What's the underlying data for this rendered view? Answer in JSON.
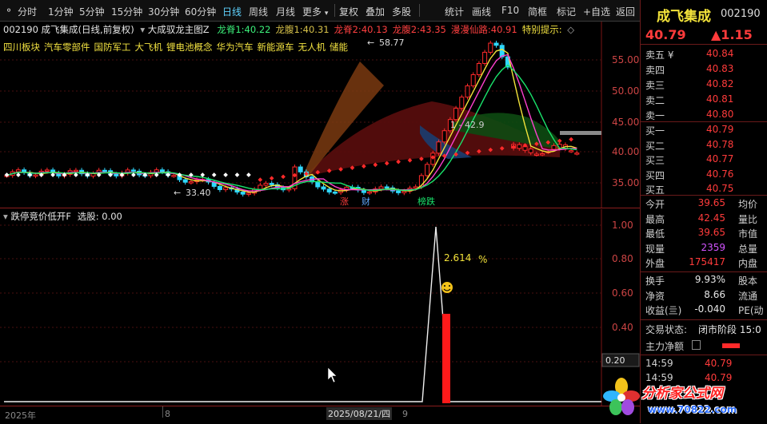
{
  "toolbar": {
    "left_items": [
      "分时",
      "1分钟",
      "5分钟",
      "15分钟",
      "30分钟",
      "60分钟",
      "日线",
      "周线",
      "月线",
      "更多"
    ],
    "active": "日线",
    "right_items": [
      "复权",
      "叠加",
      "多股",
      "统计",
      "画线",
      "F10",
      "简框",
      "标记",
      "+自选",
      "返回"
    ]
  },
  "main_legend": {
    "stock": "002190 成飞集成(日线,前复权)",
    "indicator": "大成驭龙主图Z",
    "items": [
      {
        "label": "龙脊1:",
        "value": "40.22",
        "color": "#3cf07a"
      },
      {
        "label": "龙腹1:",
        "value": "40.31",
        "color": "#d7c24a"
      },
      {
        "label": "龙脊2:",
        "value": "40.13",
        "color": "#ff4040"
      },
      {
        "label": "龙腹2:",
        "value": "43.35",
        "color": "#ff4040"
      },
      {
        "label": "漫漫仙路:",
        "value": "40.91",
        "color": "#ff4040"
      },
      {
        "label": "特别提示:",
        "value": "",
        "color": "#f0e040"
      }
    ],
    "tags": [
      "四川板块",
      "汽车零部件",
      "国防军工",
      "大飞机",
      "锂电池概念",
      "华为汽车",
      "新能源车",
      "无人机",
      "储能"
    ]
  },
  "annotations": {
    "high_label": "58.77",
    "low_label": "33.40",
    "line_label": "1 - 42.9",
    "events": [
      "涨",
      "财",
      "榜跌"
    ]
  },
  "price_axis": [
    "55.00",
    "50.00",
    "45.00",
    "40.00",
    "35.00"
  ],
  "lower_legend": {
    "name": "跌停竞价低开F",
    "select": "选股: 0.00",
    "value_label": "2.614",
    "unit": "%"
  },
  "lower_axis": [
    "1.00",
    "0.80",
    "0.60",
    "0.40",
    "0.20"
  ],
  "lower_badge": "0.20",
  "x_axis": {
    "year": "2025年",
    "tick1": "8",
    "cursor_date": "2025/08/21/四",
    "tick2": "9"
  },
  "quote": {
    "name": "成飞集成",
    "code": "002190",
    "price": "40.79",
    "change": "▲1.15",
    "sell": [
      {
        "label": "卖五 ¥",
        "price": "40.84"
      },
      {
        "label": "卖四",
        "price": "40.83"
      },
      {
        "label": "卖三",
        "price": "40.82"
      },
      {
        "label": "卖二",
        "price": "40.81"
      },
      {
        "label": "卖一",
        "price": "40.80"
      }
    ],
    "buy": [
      {
        "label": "买一",
        "price": "40.79"
      },
      {
        "label": "买二",
        "price": "40.78"
      },
      {
        "label": "买三",
        "price": "40.77"
      },
      {
        "label": "买四",
        "price": "40.76"
      },
      {
        "label": "买五",
        "price": "40.75"
      }
    ],
    "stats": [
      {
        "label": "今开",
        "value": "39.65",
        "label2": "均价",
        "color": "#ff3b3b"
      },
      {
        "label": "最高",
        "value": "42.45",
        "label2": "量比",
        "color": "#ff3b3b"
      },
      {
        "label": "最低",
        "value": "39.65",
        "label2": "市值",
        "color": "#ff3b3b"
      },
      {
        "label": "现量",
        "value": "2359",
        "label2": "总量",
        "color": "#d254ff"
      },
      {
        "label": "外盘",
        "value": "175417",
        "label2": "内盘",
        "color": "#ff3b3b"
      }
    ],
    "stats2": [
      {
        "label": "换手",
        "value": "9.93%",
        "label2": "股本",
        "color": "#e6e6e6"
      },
      {
        "label": "净资",
        "value": "8.66",
        "label2": "流通",
        "color": "#e6e6e6"
      },
      {
        "label": "收益(亖)",
        "value": "-0.040",
        "label2": "PE(动",
        "color": "#e6e6e6"
      }
    ],
    "trade_status_label": "交易状态:",
    "trade_status_value": "闭市阶段 15:0",
    "net_label": "主力净额",
    "ticks": [
      {
        "time": "14:59",
        "price": "40.79"
      },
      {
        "time": "14:59",
        "price": "40.79"
      }
    ]
  },
  "watermark": {
    "text": "分析家公式网",
    "url": "www.70822.com"
  }
}
